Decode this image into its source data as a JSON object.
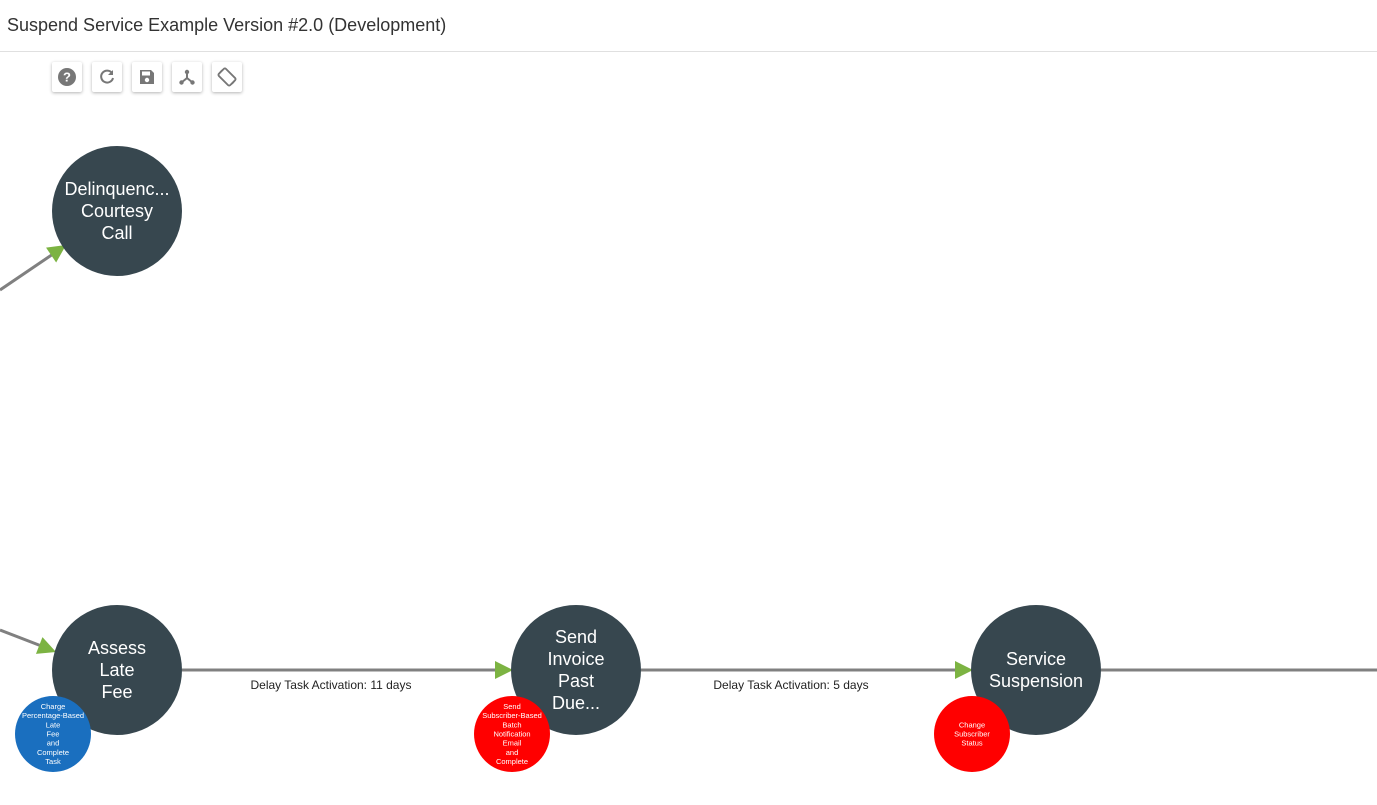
{
  "header": {
    "title": "Suspend Service Example Version #2.0 (Development)"
  },
  "toolbar": {
    "buttons": [
      {
        "icon": "help-icon",
        "name": "help-button"
      },
      {
        "icon": "refresh-icon",
        "name": "refresh-button"
      },
      {
        "icon": "save-icon",
        "name": "save-button"
      },
      {
        "icon": "hierarchy-icon",
        "name": "layout-button"
      },
      {
        "icon": "rotate-icon",
        "name": "rotate-button"
      }
    ]
  },
  "colors": {
    "node": "#37474f",
    "blue_task": "#1a6fbf",
    "red_task": "#ff0000",
    "edge": "#808080",
    "arrow": "#7cb342"
  },
  "nodes": [
    {
      "id": "delinquency",
      "lines": [
        "Delinquenc...",
        "Courtesy",
        "Call"
      ]
    },
    {
      "id": "assess",
      "lines": [
        "Assess",
        "Late",
        "Fee"
      ]
    },
    {
      "id": "invoice",
      "lines": [
        "Send",
        "Invoice",
        "Past",
        "Due..."
      ]
    },
    {
      "id": "suspension",
      "lines": [
        "Service",
        "Suspension"
      ]
    }
  ],
  "tasks": [
    {
      "id": "charge",
      "color": "blue",
      "lines": [
        "Charge",
        "Percentage-Based",
        "Late",
        "Fee",
        "and",
        "Complete",
        "Task"
      ]
    },
    {
      "id": "notify",
      "color": "red",
      "lines": [
        "Send",
        "Subscriber-Based",
        "Batch",
        "Notification",
        "Email",
        "and",
        "Complete"
      ]
    },
    {
      "id": "status",
      "color": "red",
      "lines": [
        "Change",
        "Subscriber",
        "Status"
      ]
    }
  ],
  "edges": [
    {
      "label": "Delay Task Activation: 11 days"
    },
    {
      "label": "Delay Task Activation: 5 days"
    }
  ]
}
